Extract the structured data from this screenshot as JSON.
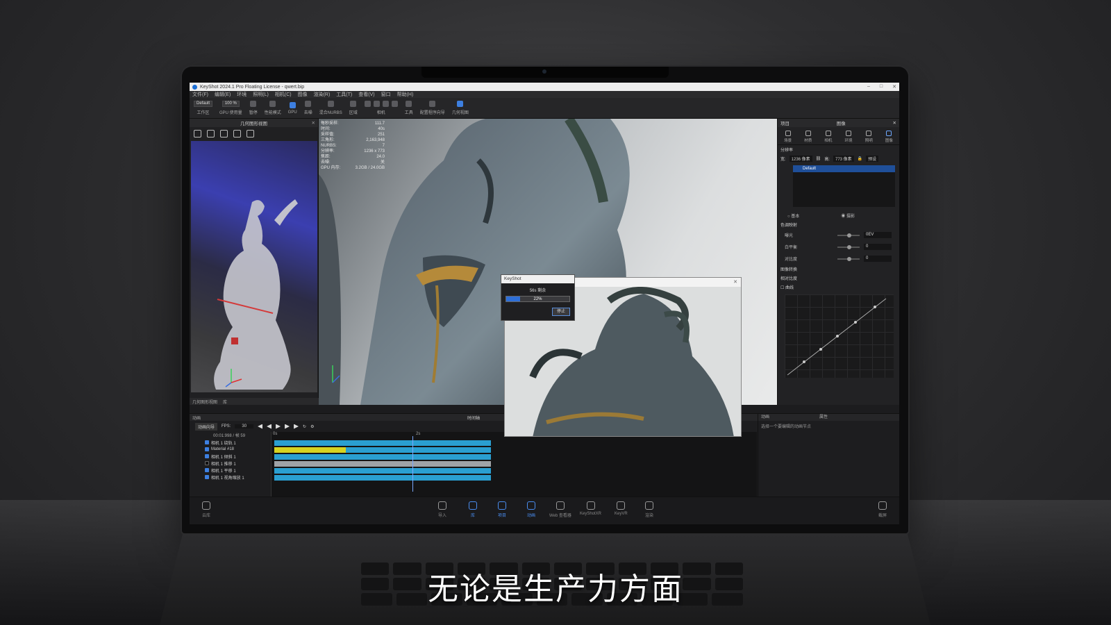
{
  "app": {
    "title": "KeyShot 2024.1 Pro Floating License - qwert.bip"
  },
  "menu": [
    "文件(F)",
    "编辑(E)",
    "环境",
    "照明(L)",
    "相机(C)",
    "图像",
    "渲染(R)",
    "工具(T)",
    "查看(V)",
    "窗口",
    "帮助(H)"
  ],
  "toolbar": {
    "preset_select": "Default",
    "zoom_select": "100 %",
    "labels": [
      "工作区",
      "GPU 使用量",
      "暂停",
      "性能模式",
      "GPU",
      "去噪",
      "混合NURBS",
      "区域",
      "相机",
      "工具",
      "配置程序向导",
      "几何视图"
    ]
  },
  "left_panel": {
    "title": "几何图形视图",
    "tabs": [
      "几何图形视图",
      "库"
    ]
  },
  "stats": [
    {
      "label": "每秒采样:",
      "value": "111.7"
    },
    {
      "label": "时间:",
      "value": "40s"
    },
    {
      "label": "采样值:",
      "value": "251"
    },
    {
      "label": "三角形:",
      "value": "2,163,948"
    },
    {
      "label": "NURBS:",
      "value": "7"
    },
    {
      "label": "分辨率:",
      "value": "1236 x 773"
    },
    {
      "label": "焦距:",
      "value": "24.0"
    },
    {
      "label": "去噪:",
      "value": "关"
    },
    {
      "label": "GPU 内存:",
      "value": "3.2GB / 24.0GB"
    }
  ],
  "progress_dialog": {
    "title": "KeyShot",
    "remaining": "56s 剩余",
    "percent_label": "22%",
    "progress": 0.22,
    "stop_button": "停止"
  },
  "right_panel": {
    "tab_header_left": "项目",
    "tab_header_active": "图像",
    "tabs": [
      "场景",
      "材质",
      "相机",
      "环境",
      "照明",
      "图像"
    ],
    "section_resolution": "分辨率",
    "width_label": "宽:",
    "width_value": "1236 像素",
    "height_label": "高:",
    "height_value": "773 像素",
    "preset_dropdown": "预设",
    "preset_item": "Default",
    "mode_basic": "基本",
    "mode_photo": "摄影",
    "section_tonemap": "色调映射",
    "exposure_label": "曝光",
    "exposure_value": "0EV",
    "white_balance_label": "白平衡",
    "white_balance_value": "0",
    "contrast_label": "对比度",
    "contrast_value": "0",
    "image_transform_label": "图像转换",
    "image_transform_value": "相对比度",
    "curve_label": "曲线"
  },
  "timeline": {
    "panel_label": "动画",
    "center_label": "时间轴",
    "wizard_button": "动画向导",
    "fps_label": "FPS:",
    "fps_value": "30",
    "time_readout": "00:01:998 / 帧 59",
    "ruler": [
      "0s",
      "2s"
    ],
    "tracks": [
      {
        "name": "相机 1 绕轨 1",
        "checked": true
      },
      {
        "name": "Material #18",
        "checked": true
      },
      {
        "name": "相机 1 倾斜 1",
        "checked": true
      },
      {
        "name": "相机 1 推移 1",
        "checked": false
      },
      {
        "name": "相机 1 平移 1",
        "checked": true
      },
      {
        "name": "相机 1 视角缩放 1",
        "checked": true
      }
    ]
  },
  "anim_panel": {
    "tab_anim": "动画",
    "tab_props": "属性",
    "hint": "选择一个要编辑的动画节点"
  },
  "bottom_bar": {
    "cloud": "云库",
    "items": [
      "导入",
      "库",
      "项目",
      "动画",
      "Web 查看器",
      "KeyShotXR",
      "KeyVR",
      "渲染"
    ],
    "screenshot": "截屏"
  },
  "subtitle": "无论是生产力方面"
}
